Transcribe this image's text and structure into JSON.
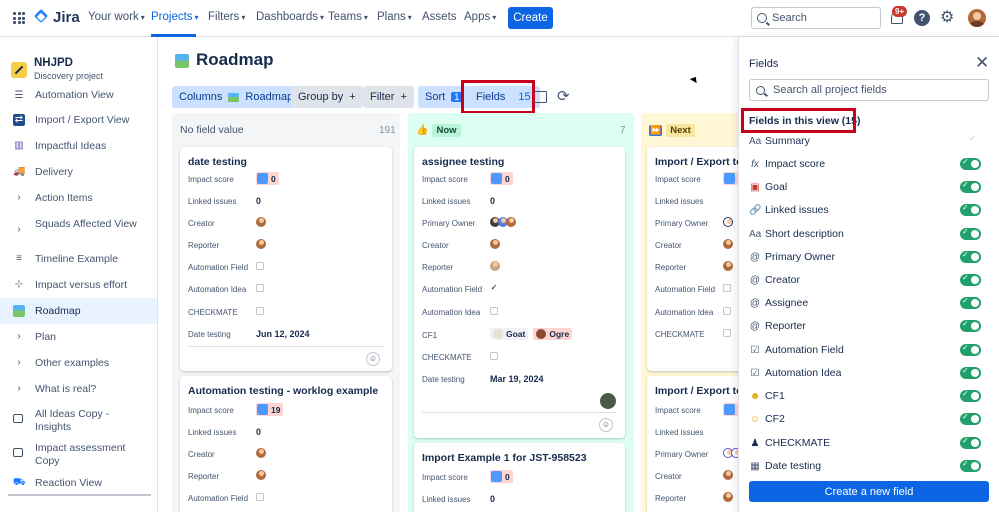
{
  "topnav": {
    "product": "Jira",
    "items": [
      {
        "label": "Your work"
      },
      {
        "label": "Projects"
      },
      {
        "label": "Filters"
      },
      {
        "label": "Dashboards"
      },
      {
        "label": "Teams"
      },
      {
        "label": "Plans"
      },
      {
        "label": "Assets"
      },
      {
        "label": "Apps"
      }
    ],
    "create_label": "Create",
    "search_placeholder": "Search",
    "notification_count": "9+",
    "accent": "#0c66e4"
  },
  "sidebar": {
    "project_name": "NHJPD",
    "project_type": "Discovery project",
    "items": [
      {
        "label": "Automation View",
        "icon": "list-icon"
      },
      {
        "label": "Import / Export View",
        "icon": "arrows-icon"
      },
      {
        "label": "Impactful Ideas",
        "icon": "bar-chart-icon"
      },
      {
        "label": "Delivery",
        "icon": "truck-icon"
      },
      {
        "label": "Action Items",
        "icon": "chevron-right-icon"
      },
      {
        "label": "Squads Affected View",
        "icon": "chevron-right-icon"
      },
      {
        "label": "Timeline Example",
        "icon": "timeline-icon"
      },
      {
        "label": "Impact versus effort",
        "icon": "matrix-icon"
      },
      {
        "label": "Roadmap",
        "icon": "roadmap-icon"
      },
      {
        "label": "Plan",
        "icon": "chevron-right-icon"
      },
      {
        "label": "Other examples",
        "icon": "chevron-right-icon"
      },
      {
        "label": "What is real?",
        "icon": "chevron-right-icon"
      },
      {
        "label": "All Ideas Copy - Insights",
        "icon": "table-icon"
      },
      {
        "label": "Impact assessment Copy",
        "icon": "table-icon"
      },
      {
        "label": "Reaction View",
        "icon": "reaction-icon"
      }
    ]
  },
  "main": {
    "title": "Roadmap",
    "toolbar": {
      "columns_label": "Columns",
      "columns_value": "Roadmap",
      "group_by_label": "Group by",
      "filter_label": "Filter",
      "sort_label": "Sort",
      "sort_count": "1",
      "fields_label": "Fields",
      "fields_count": "15",
      "plus": "+"
    },
    "columns": [
      {
        "label": "No field value",
        "count": "191"
      },
      {
        "label": "Now",
        "count": "7"
      },
      {
        "label": "Next",
        "count": ""
      }
    ],
    "field_labels": {
      "impact_score": "Impact score",
      "linked_issues": "Linked issues",
      "creator": "Creator",
      "reporter": "Reporter",
      "automation_field": "Automation Field",
      "automation_idea": "Automation Idea",
      "checkmate": "CHECKMATE",
      "date_testing": "Date testing",
      "primary_owner": "Primary Owner",
      "cf1": "CF1"
    },
    "cards": {
      "c1": {
        "title": "date testing",
        "impact": "0",
        "linked": "0",
        "date": "Jun 12, 2024"
      },
      "c2": {
        "title": "Automation testing - worklog example",
        "impact": "19",
        "linked": "0"
      },
      "c3": {
        "title": "assignee testing",
        "impact": "0",
        "linked": "0",
        "cf1_a": "Goat",
        "cf1_b": "Ogre",
        "date": "Mar 19, 2024"
      },
      "c4": {
        "title": "Import Example 1 for JST-958523",
        "impact": "0",
        "linked": "0"
      },
      "c5": {
        "title": "Import / Export tes"
      },
      "c6": {
        "title": "Import / Export tes"
      }
    }
  },
  "panel": {
    "title": "Fields",
    "search_placeholder": "Search all project fields",
    "section": "Fields in this view (15)",
    "fields": [
      {
        "label": "Summary",
        "icon": "text-icon",
        "enabled": true,
        "locked": true
      },
      {
        "label": "Impact score",
        "icon": "formula-icon",
        "enabled": true
      },
      {
        "label": "Goal",
        "icon": "goal-icon",
        "enabled": true
      },
      {
        "label": "Linked issues",
        "icon": "link-icon",
        "enabled": true
      },
      {
        "label": "Short description",
        "icon": "text-icon",
        "enabled": true
      },
      {
        "label": "Primary Owner",
        "icon": "at-icon",
        "enabled": true
      },
      {
        "label": "Creator",
        "icon": "at-icon",
        "enabled": true
      },
      {
        "label": "Assignee",
        "icon": "at-icon",
        "enabled": true
      },
      {
        "label": "Reporter",
        "icon": "at-icon",
        "enabled": true
      },
      {
        "label": "Automation Field",
        "icon": "checkbox-icon",
        "enabled": true
      },
      {
        "label": "Automation Idea",
        "icon": "checkbox-icon",
        "enabled": true
      },
      {
        "label": "CF1",
        "icon": "emoji-icon",
        "enabled": true
      },
      {
        "label": "CF2",
        "icon": "emoji-icon",
        "enabled": true
      },
      {
        "label": "CHECKMATE",
        "icon": "chess-icon",
        "enabled": true
      },
      {
        "label": "Date testing",
        "icon": "calendar-icon",
        "enabled": true
      }
    ],
    "create_label": "Create a new field",
    "toggle_color": "#22a06b"
  }
}
